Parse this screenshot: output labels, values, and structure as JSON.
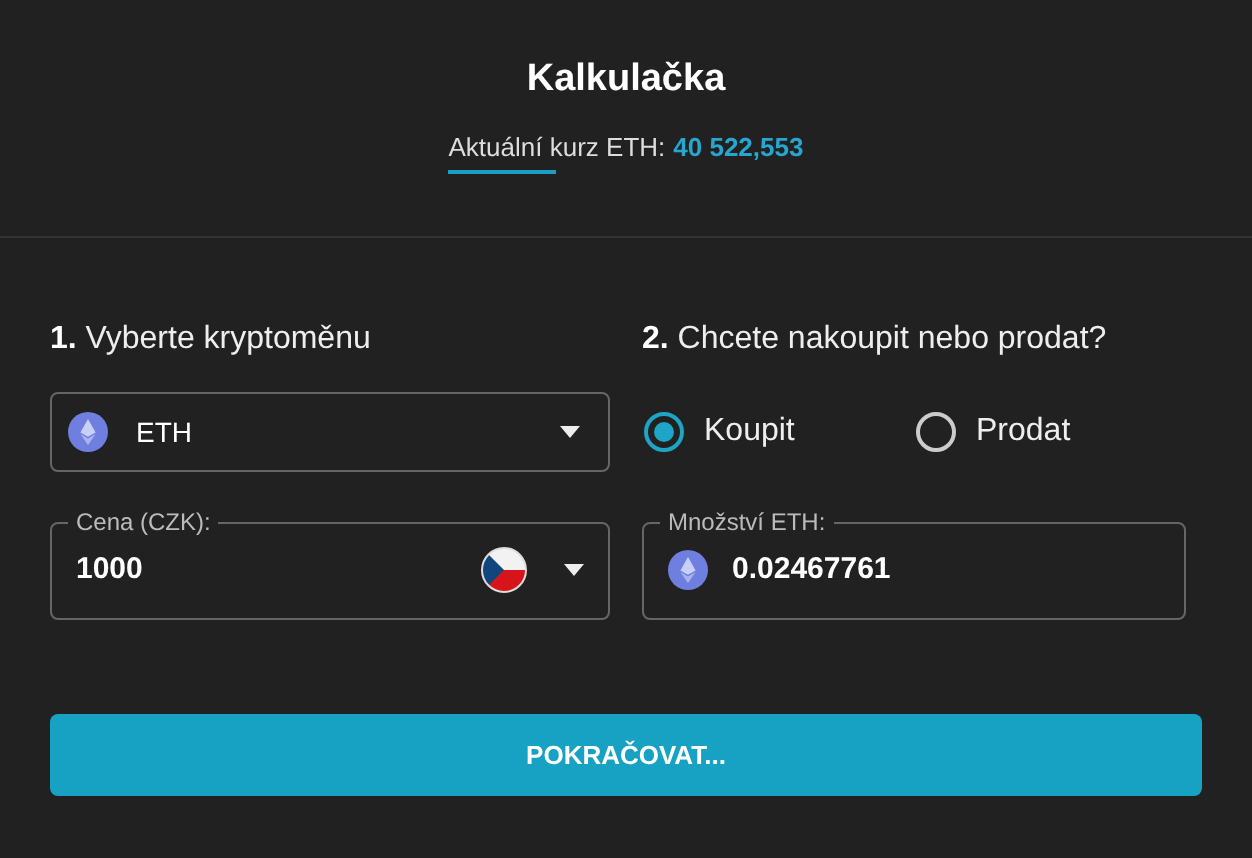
{
  "title": "Kalkulačka",
  "rate": {
    "label": "Aktuální kurz ETH:",
    "value": "40 522,553"
  },
  "step_1": {
    "heading": "**1.** Vyberte kryptoměnu",
    "crypto_select": {
      "value": "ETH"
    },
    "price_field": {
      "label": "Cena (CZK):",
      "value": "1000"
    }
  },
  "step_2": {
    "heading": "**2.** Chcete nakoupit nebo prodat?",
    "options": [
      {
        "label": "Koupit",
        "selected": true
      },
      {
        "label": "Prodat",
        "selected": false
      }
    ],
    "amount_field": {
      "label": "Množství ETH:",
      "value": "0.02467761"
    }
  },
  "submit_button": "POKRAČOVAT..."
}
